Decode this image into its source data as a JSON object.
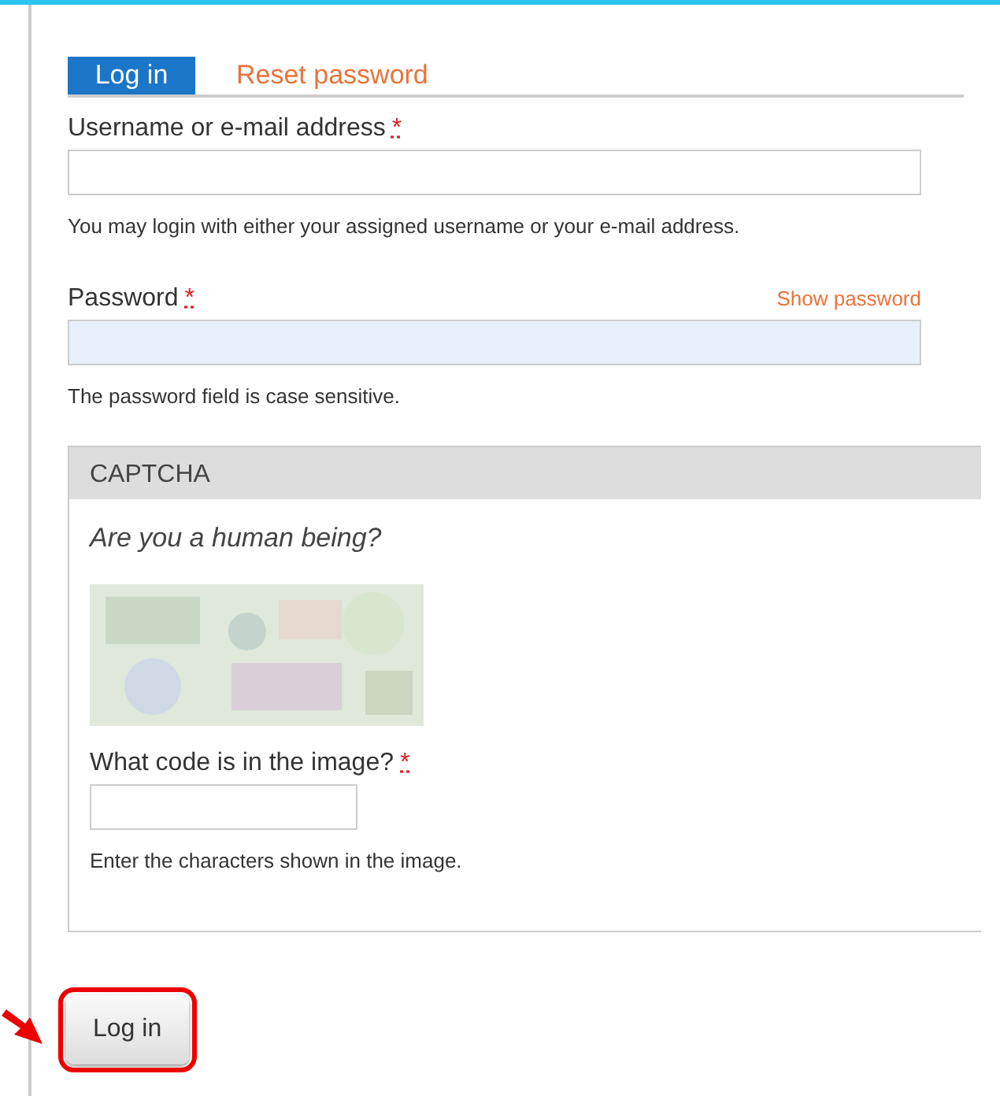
{
  "tabs": [
    {
      "label": "Log in",
      "selected": true
    },
    {
      "label": "Reset password",
      "selected": false
    }
  ],
  "fields": [
    {
      "label": "Username or e-mail address",
      "required_mark": "*",
      "highlighted": false,
      "help": "You may login with either your assigned username or your e-mail address."
    },
    {
      "label": "Password",
      "required_mark": "*",
      "toggle": "Show password",
      "highlighted": true,
      "help": "The password field is case sensitive."
    }
  ],
  "captcha": {
    "title": "CAPTCHA",
    "question": "Are you a human being?",
    "field": {
      "label": "What code is in the image?",
      "required_mark": "*",
      "highlighted": false,
      "help": "Enter the characters shown in the image."
    }
  },
  "submit": {
    "label": "Log in",
    "callout": true
  }
}
